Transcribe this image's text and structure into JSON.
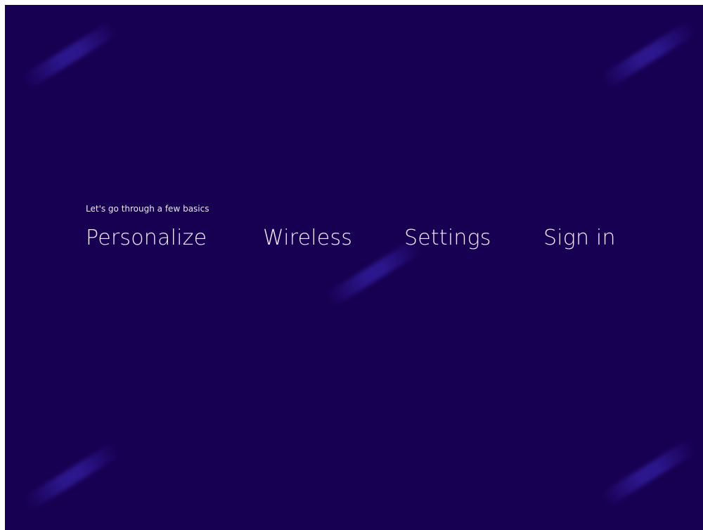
{
  "setup": {
    "subtitle": "Let's go through a few basics",
    "steps": [
      {
        "label": "Personalize"
      },
      {
        "label": "Wireless"
      },
      {
        "label": "Settings"
      },
      {
        "label": "Sign in"
      }
    ]
  },
  "colors": {
    "background": "#170052",
    "text": "#eceaf6",
    "accent_streak": "#4632d2"
  }
}
